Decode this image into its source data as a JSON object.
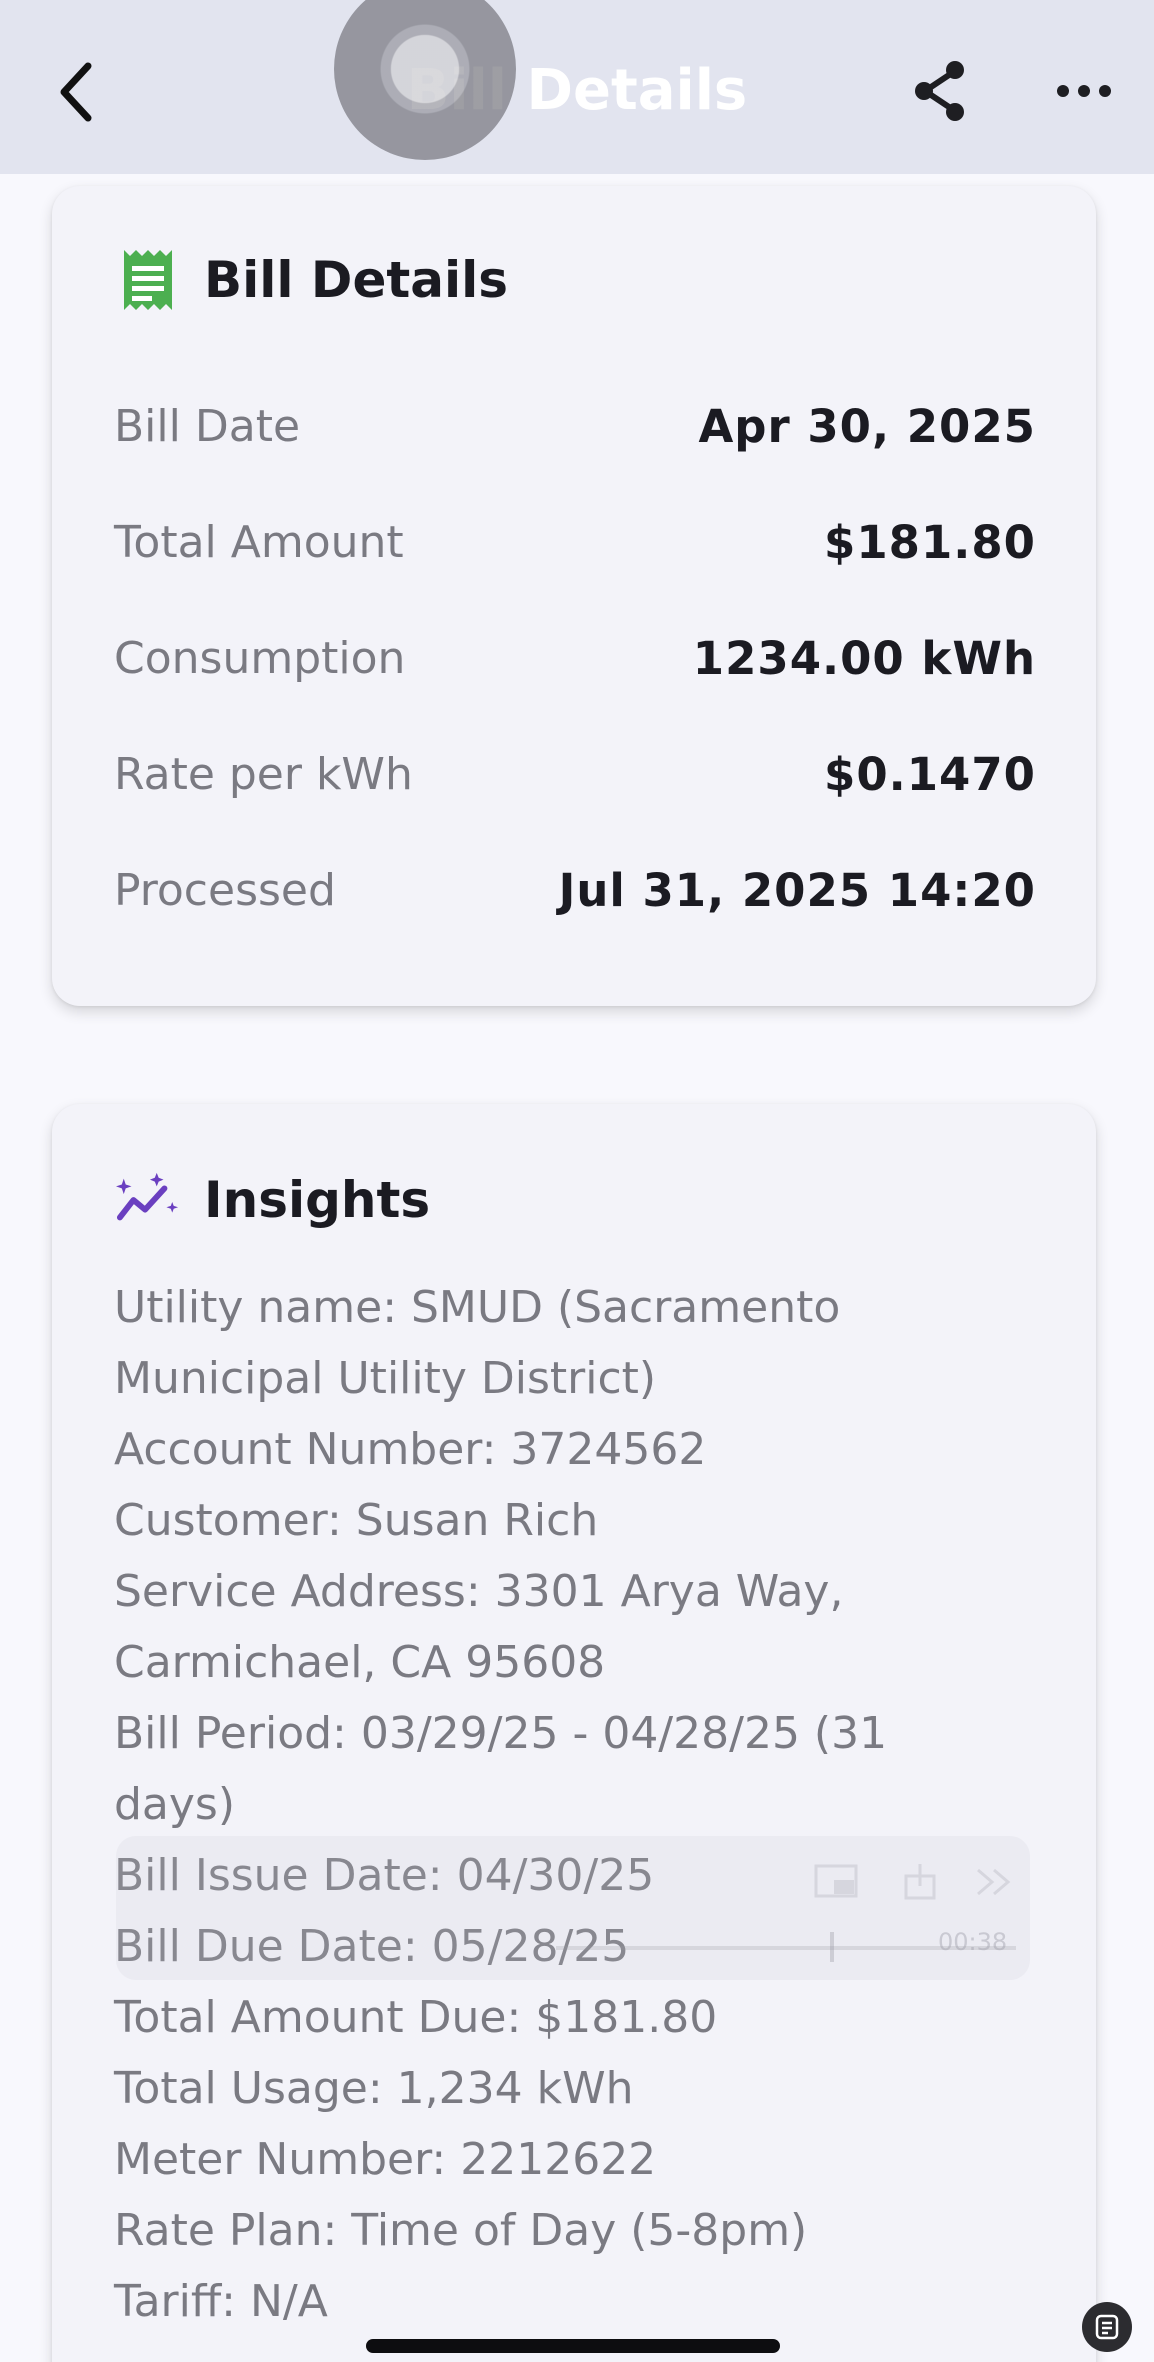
{
  "nav": {
    "title": "Bill Details",
    "icons": {
      "back": "chevron-left-icon",
      "share": "share-icon",
      "more": "more-horizontal-icon"
    }
  },
  "details": {
    "title": "Bill Details",
    "icon": "receipt-icon",
    "rows": [
      {
        "label": "Bill Date",
        "value": "Apr 30, 2025"
      },
      {
        "label": "Total Amount",
        "value": "$181.80"
      },
      {
        "label": "Consumption",
        "value": "1234.00 kWh"
      },
      {
        "label": "Rate per kWh",
        "value": "$0.1470"
      },
      {
        "label": "Processed",
        "value": "Jul 31, 2025 14:20"
      }
    ]
  },
  "insights": {
    "title": "Insights",
    "icon": "sparkle-chart-icon",
    "lines": [
      "Utility name: SMUD (Sacramento",
      "Municipal Utility District)",
      "Account Number: 3724562",
      "Customer: Susan Rich",
      "Service Address: 3301 Arya Way,",
      "Carmichael, CA 95608",
      "Bill Period: 03/29/25 - 04/28/25 (31",
      "days)",
      "Bill Issue Date: 04/30/25",
      "Bill Due Date: 05/28/25",
      "Total Amount Due: $181.80",
      "Total Usage: 1,234 kWh",
      "Meter Number: 2212622",
      "Rate Plan: Time of Day (5-8pm)",
      "Tariff: N/A"
    ]
  },
  "video_overlay": {
    "time": "00:38"
  },
  "colors": {
    "navbar": "#e2e4ef",
    "page": "#f8f8fd",
    "card": "#f3f3f9",
    "receipt_icon": "#4caf50",
    "insights_icon": "#6a3fc0"
  }
}
